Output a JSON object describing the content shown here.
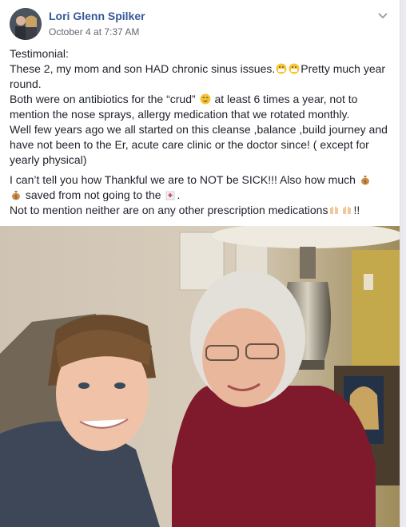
{
  "post": {
    "author": "Lori Glenn Spilker",
    "timestamp": "October 4 at 7:37 AM",
    "body": {
      "line1": "Testimonial:",
      "line2a": "These 2, my mom and son HAD chronic sinus issues.",
      "line2b": "Pretty much year round.",
      "line3a": "Both were on antibiotics for the “crud”",
      "line3b": " at least 6 times a year, not to mention the nose sprays, allergy medication that we rotated monthly.",
      "line4": "Well few years ago we all started on this cleanse ,balance ,build journey and have not been to the Er, acute care clinic or the doctor since! ( except for yearly physical)",
      "line5a": "I can’t tell you how Thankful we are to NOT be SICK!!! Also how much",
      "line5b": "saved from not going to the",
      "line5c": ".",
      "line6a": "Not to mention neither are on any other prescription medications",
      "line6b": "!!"
    }
  },
  "icons": {
    "avatar": "profile-photo",
    "menu": "chevron-down-icon",
    "emoji_sick": "face-with-medical-mask-emoji",
    "emoji_relieved": "relieved-face-emoji",
    "emoji_money": "money-bag-emoji",
    "emoji_hospital": "hospital-emoji",
    "emoji_praise": "raising-hands-emoji"
  },
  "colors": {
    "author_link": "#365899",
    "text": "#1d2129",
    "meta": "#616770"
  }
}
